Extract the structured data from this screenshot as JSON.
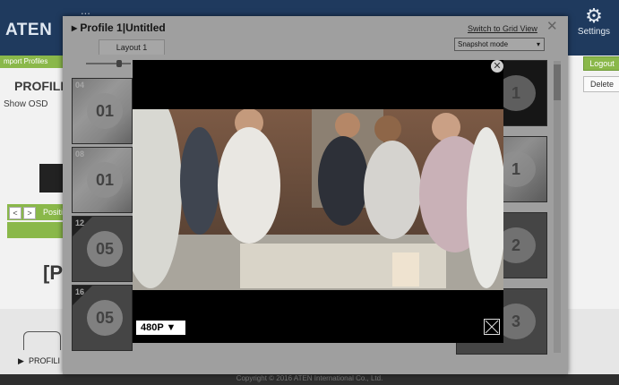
{
  "app": {
    "logo": "ATEN",
    "title": "...",
    "settings_label": "Settings",
    "import_profiles": "mport Profiles",
    "logout_label": "Logout",
    "delete_label": "Delete",
    "profile_label": "PROFILE",
    "show_osd": "Show OSD",
    "nav_prev": "<",
    "nav_next": ">",
    "position_label": "Positi",
    "bracket_p": "[P",
    "bottom_profile": "PROFILI",
    "footer": "Copyright © 2016 ATEN International Co., Ltd."
  },
  "dialog": {
    "title": "Profile 1|Untitled",
    "close": "✕",
    "grid_link": "Switch to Grid View",
    "snapshot_mode": "Snapshot mode",
    "layout_tab": "Layout 1",
    "left_thumbs": [
      {
        "num": "04",
        "badge": "01"
      },
      {
        "num": "08",
        "badge": "01"
      },
      {
        "num": "12",
        "badge": "05"
      },
      {
        "num": "16",
        "badge": "05"
      }
    ],
    "right_thumbs": [
      {
        "badge": "1"
      },
      {
        "badge": "1"
      },
      {
        "badge": "2"
      },
      {
        "badge": "3"
      }
    ]
  },
  "player": {
    "close_icon": "✕",
    "resolution": "480P ▼"
  }
}
